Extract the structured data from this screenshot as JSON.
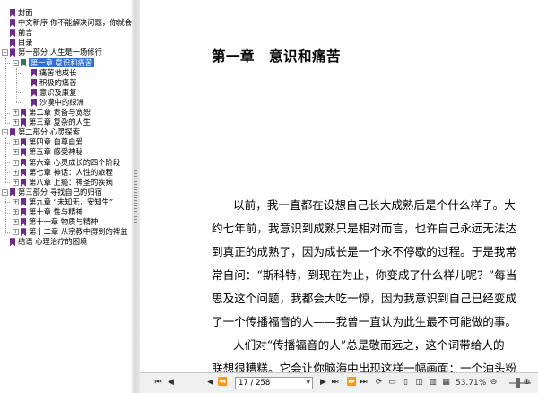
{
  "sidebar": {
    "items": [
      {
        "label": "封面",
        "depth": 0,
        "has_toggle": false,
        "expanded": false,
        "selected": false
      },
      {
        "label": "中文新序 你不能解决问题，你就会成为问题",
        "depth": 0,
        "has_toggle": false,
        "expanded": false,
        "selected": false
      },
      {
        "label": "前言",
        "depth": 0,
        "has_toggle": false,
        "expanded": false,
        "selected": false
      },
      {
        "label": "目录",
        "depth": 0,
        "has_toggle": false,
        "expanded": false,
        "selected": false
      },
      {
        "label": "第一部分 人生是一场修行",
        "depth": 0,
        "has_toggle": true,
        "expanded": true,
        "selected": false
      },
      {
        "label": "第一章 意识和痛苦",
        "depth": 1,
        "has_toggle": true,
        "expanded": true,
        "selected": true
      },
      {
        "label": "痛苦地成长",
        "depth": 2,
        "has_toggle": false,
        "expanded": false,
        "selected": false
      },
      {
        "label": "积极的痛苦",
        "depth": 2,
        "has_toggle": false,
        "expanded": false,
        "selected": false
      },
      {
        "label": "意识及康复",
        "depth": 2,
        "has_toggle": false,
        "expanded": false,
        "selected": false
      },
      {
        "label": "沙漠中的绿洲",
        "depth": 2,
        "has_toggle": false,
        "expanded": false,
        "selected": false
      },
      {
        "label": "第二章 责备与宽恕",
        "depth": 1,
        "has_toggle": true,
        "expanded": false,
        "selected": false
      },
      {
        "label": "第三章 复杂的人生",
        "depth": 1,
        "has_toggle": true,
        "expanded": false,
        "selected": false
      },
      {
        "label": "第二部分 心灵探索",
        "depth": 0,
        "has_toggle": true,
        "expanded": true,
        "selected": false
      },
      {
        "label": "第四章 自尊自爱",
        "depth": 1,
        "has_toggle": true,
        "expanded": false,
        "selected": false
      },
      {
        "label": "第五章 感受神秘",
        "depth": 1,
        "has_toggle": true,
        "expanded": false,
        "selected": false
      },
      {
        "label": "第六章 心灵成长的四个阶段",
        "depth": 1,
        "has_toggle": true,
        "expanded": false,
        "selected": false
      },
      {
        "label": "第七章 神话：人性的旅程",
        "depth": 1,
        "has_toggle": true,
        "expanded": false,
        "selected": false
      },
      {
        "label": "第八章 上瘾：神圣的疾病",
        "depth": 1,
        "has_toggle": true,
        "expanded": false,
        "selected": false
      },
      {
        "label": "第三部分 寻找自己的归宿",
        "depth": 0,
        "has_toggle": true,
        "expanded": true,
        "selected": false
      },
      {
        "label": "第九章 “未知无，安知生”",
        "depth": 1,
        "has_toggle": true,
        "expanded": false,
        "selected": false
      },
      {
        "label": "第十章 性与精神",
        "depth": 1,
        "has_toggle": true,
        "expanded": false,
        "selected": false
      },
      {
        "label": "第十一章 物质与精神",
        "depth": 1,
        "has_toggle": true,
        "expanded": false,
        "selected": false
      },
      {
        "label": "第十二章 从宗教中得到的裨益",
        "depth": 1,
        "has_toggle": true,
        "expanded": false,
        "selected": false
      },
      {
        "label": "结语 心理治疗的困境",
        "depth": 0,
        "has_toggle": false,
        "expanded": false,
        "selected": false
      }
    ]
  },
  "document": {
    "chapter_title": "第一章　意识和痛苦",
    "lines": [
      "以前，我一直都在设想自己长大成熟后是个什么样子。大",
      "约七年前，我意识到成熟只是相对而言，也许自己永远无法达",
      "到真正的成熟了，因为成长是一个永不停歇的过程。于是我常",
      "常自问：“斯科特，到现在为止，你变成了什么样儿呢？”每当",
      "思及这个问题，我都会大吃一惊，因为我意识到自己已经变成",
      "了一个传播福音的人——我曾一直认为此生最不可能做的事。",
      "人们对“传播福音的人”总是敬而远之，这个词带给人的",
      "联想很糟糕。它会让你脑海中出现这样一幅画面：一个油头粉"
    ]
  },
  "statusbar": {
    "page_field": "17 / 258",
    "zoom": "53.71%"
  },
  "colors": {
    "bookmark": "#6e2a8a",
    "bookmark_selected": "#2c7a63",
    "selection": "#2f6fd6"
  }
}
